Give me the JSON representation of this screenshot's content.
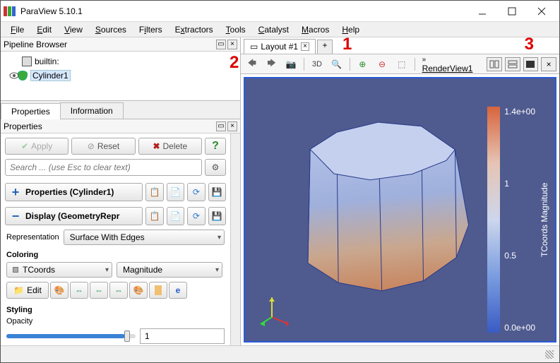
{
  "window": {
    "title": "ParaView 5.10.1"
  },
  "menu": {
    "file": "File",
    "edit": "Edit",
    "view": "View",
    "sources": "Sources",
    "filters": "Filters",
    "extractors": "Extractors",
    "tools": "Tools",
    "catalyst": "Catalyst",
    "macros": "Macros",
    "help": "Help"
  },
  "pipeline": {
    "title": "Pipeline Browser",
    "server": "builtin:",
    "items": [
      {
        "name": "Cylinder1",
        "visible": true
      }
    ]
  },
  "tabs": {
    "properties": "Properties",
    "information": "Information"
  },
  "properties": {
    "panel_title": "Properties",
    "apply": "Apply",
    "reset": "Reset",
    "delete": "Delete",
    "search_placeholder": "Search ... (use Esc to clear text)",
    "section_properties": "Properties (Cylinder1)",
    "section_display": "Display (GeometryRepr",
    "representation_label": "Representation",
    "representation_value": "Surface With Edges",
    "coloring_label": "Coloring",
    "coloring_array": "TCoords",
    "coloring_component": "Magnitude",
    "edit_label": "Edit",
    "styling_label": "Styling",
    "opacity_label": "Opacity",
    "opacity_value": "1"
  },
  "layout": {
    "tab_label": "Layout #1",
    "render_view_label": "RenderView1",
    "toolbar_3d": "3D"
  },
  "annotations": {
    "one": "1",
    "two": "2",
    "three": "3"
  },
  "colorbar": {
    "title": "TCoords Magnitude",
    "ticks": [
      "1.4e+00",
      "1",
      "0.5",
      "0.0e+00"
    ]
  },
  "chart_data": {
    "type": "3d_render",
    "object": "Cylinder",
    "representation": "Surface With Edges",
    "color_by": {
      "array": "TCoords",
      "component": "Magnitude"
    },
    "scalar_range": [
      0.0,
      1.4
    ],
    "gradient": "cool-to-warm",
    "camera_rotation_deg_approx": -6
  }
}
